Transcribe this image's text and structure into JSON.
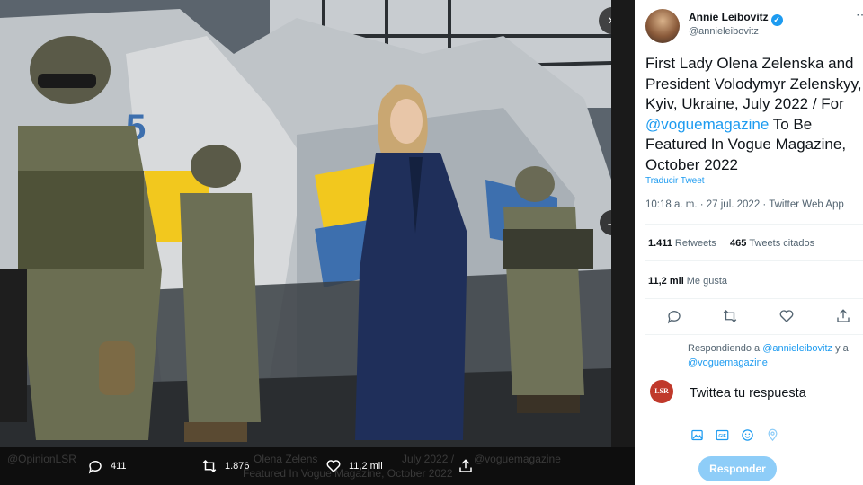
{
  "photo": {
    "description_icon": "airplane-wreck-photo",
    "ghost_caption_1": "@OpinionLSR",
    "ghost_caption_2": "Olena Zelens",
    "ghost_caption_3": "July 2022 /",
    "ghost_caption_4": "@voguemagazine",
    "ghost_caption_5": "Featured In Vogue Magazine, October 2022",
    "expand_icon": "double-chevron-right-icon",
    "next_icon": "arrow-right-icon"
  },
  "photo_actions": {
    "reply_count": "411",
    "retweet_count": "1.876",
    "like_count": "11,2 mil"
  },
  "tweet": {
    "author_name": "Annie Leibovitz",
    "author_handle": "@annieleibovitz",
    "text_before": "First Lady Olena Zelenska and President Volodymyr Zelenskyy, Kyiv, Ukraine, July 2022 / For ",
    "mention": "@voguemagazine",
    "text_after": " To Be Featured In Vogue Magazine, October 2022",
    "translate": "Traducir Tweet",
    "meta": "10:18 a. m. · 27 jul. 2022 · Twitter Web App",
    "retweets_value": "1.411",
    "retweets_label": "Retweets",
    "quotes_value": "465",
    "quotes_label": "Tweets citados",
    "likes_value": "11,2 mil",
    "likes_label": "Me gusta"
  },
  "reply": {
    "replying_prefix": "Respondiendo a ",
    "replying_to_1": "@annieleibovitz",
    "replying_mid": " y a",
    "replying_to_2": "@voguemagazine",
    "avatar_text": "LSR",
    "placeholder": "Twittea tu respuesta",
    "button": "Responder"
  },
  "colors": {
    "accent": "#1d9bf0",
    "button_disabled": "#8ecdf8"
  }
}
